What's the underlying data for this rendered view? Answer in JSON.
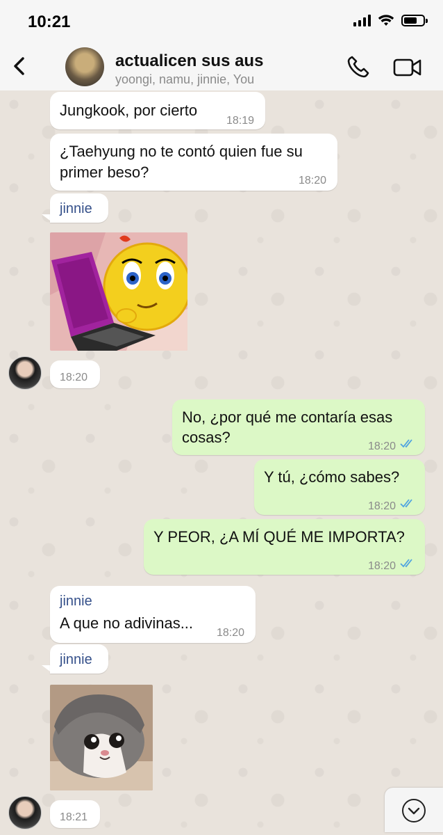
{
  "status_bar": {
    "time": "10:21",
    "battery_level": 0.7
  },
  "header": {
    "title": "actualicen sus aus",
    "members": "yoongi, namu, jinnie, You",
    "icons": [
      "back-chevron-icon",
      "phone-icon",
      "video-camera-icon"
    ]
  },
  "messages": [
    {
      "direction": "in",
      "text": "Jungkook, por cierto",
      "time": "18:19"
    },
    {
      "direction": "in",
      "text_line1": "¿Taehyung no te contó quien fue su",
      "text_line2": "primer beso?",
      "time": "18:20"
    },
    {
      "direction": "in",
      "sender": "jinnie"
    },
    {
      "direction": "in",
      "type": "sticker",
      "sticker": "smiley-laptop-sticker",
      "time": "18:20"
    },
    {
      "direction": "out",
      "text_line1": "No, ¿por qué me contaría esas",
      "text_line2": "cosas?",
      "time": "18:20",
      "status": "read"
    },
    {
      "direction": "out",
      "text": "Y tú, ¿cómo sabes?",
      "time": "18:20",
      "status": "read"
    },
    {
      "direction": "out",
      "text": "Y PEOR, ¿A MÍ QUÉ ME IMPORTA?",
      "time": "18:20",
      "status": "read"
    },
    {
      "direction": "in",
      "sender": "jinnie",
      "text": "A que no adivinas...",
      "time": "18:20"
    },
    {
      "direction": "in",
      "sender": "jinnie"
    },
    {
      "direction": "in",
      "type": "sticker",
      "sticker": "cat-sticker",
      "time": "18:21"
    }
  ],
  "colors": {
    "incoming_bubble": "#ffffff",
    "outgoing_bubble": "#dcf8c6",
    "sender_name": "#35508a",
    "read_ticks": "#4fa3e0"
  }
}
